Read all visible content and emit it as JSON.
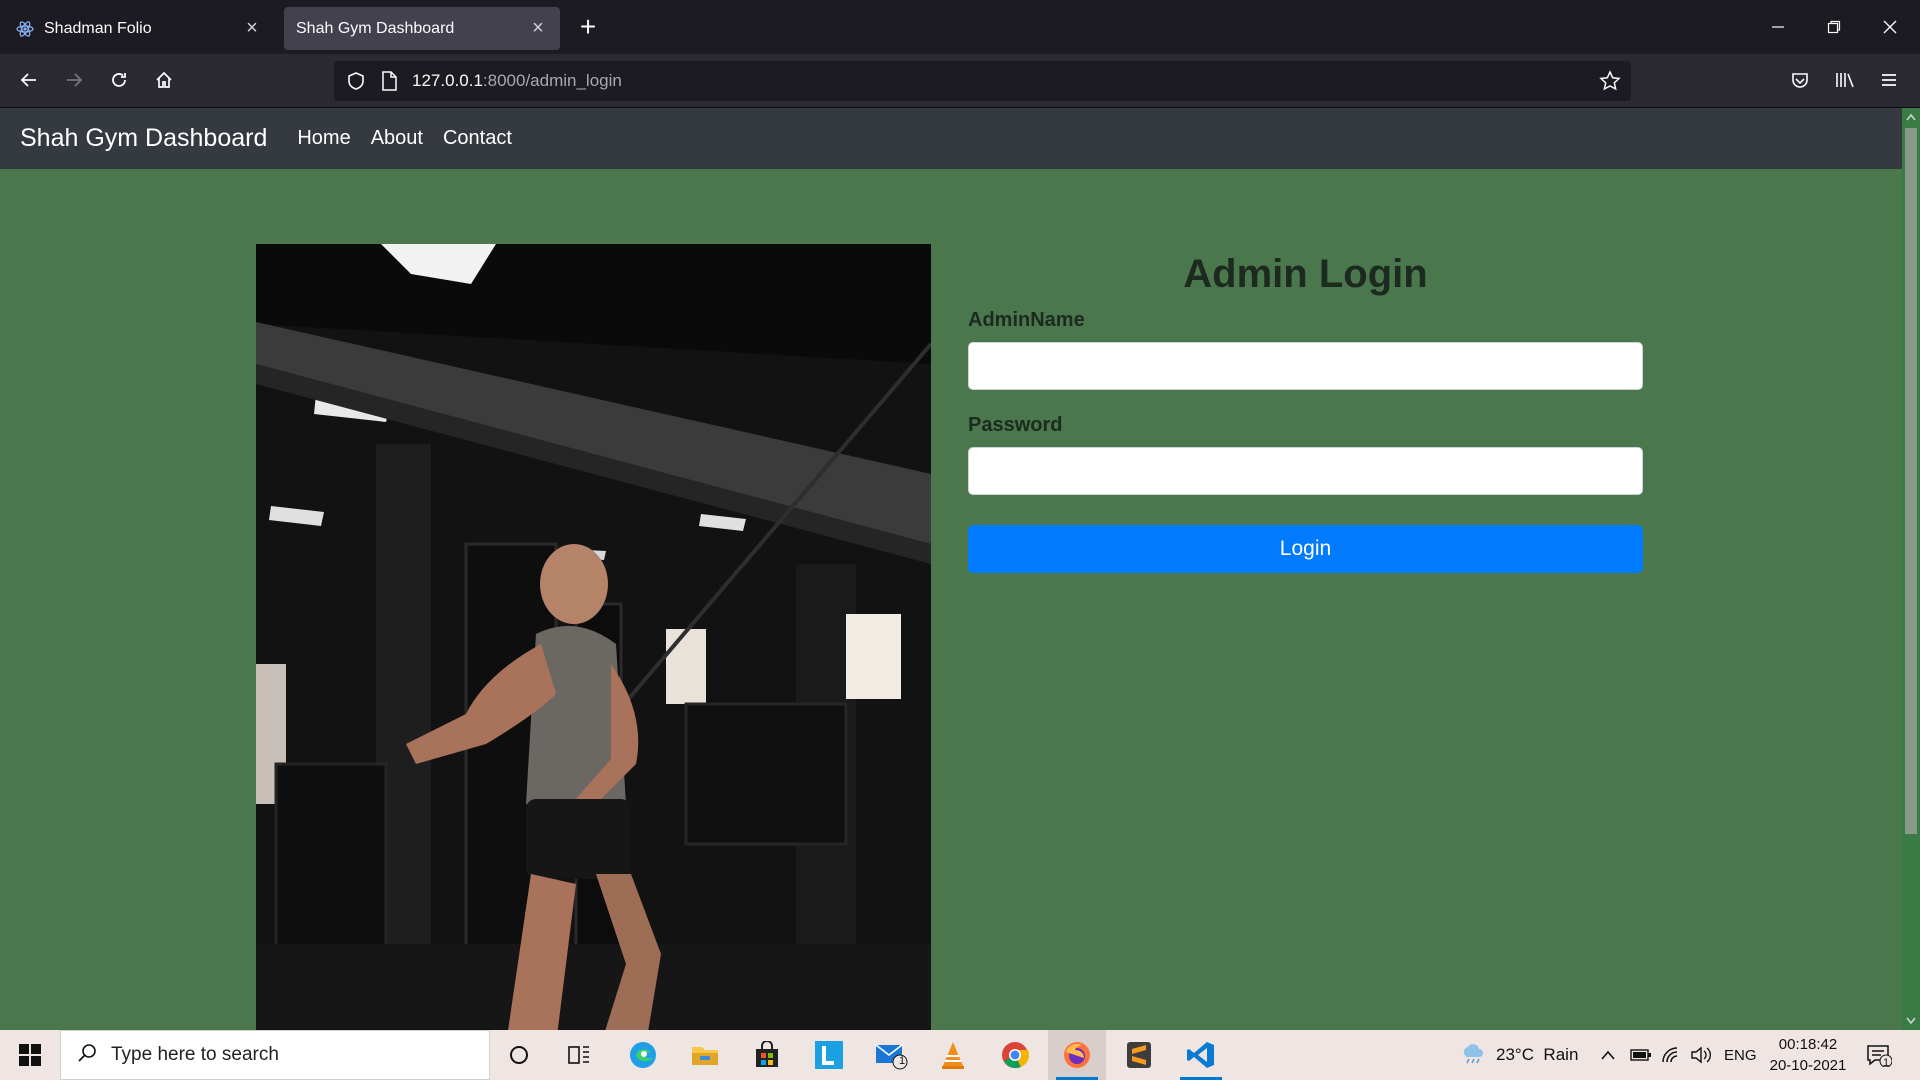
{
  "browser": {
    "tabs": [
      {
        "title": "Shadman Folio",
        "active": false
      },
      {
        "title": "Shah Gym Dashboard",
        "active": true
      }
    ],
    "url_host": "127.0.0.1",
    "url_rest": ":8000/admin_login"
  },
  "site": {
    "brand": "Shah Gym Dashboard",
    "nav": [
      "Home",
      "About",
      "Contact"
    ],
    "background": "#4a774c"
  },
  "login": {
    "heading": "Admin Login",
    "admin_label": "AdminName",
    "password_label": "Password",
    "button_label": "Login",
    "admin_value": "",
    "password_value": "",
    "button_color": "#007bff"
  },
  "taskbar": {
    "search_placeholder": "Type here to search",
    "weather": "23°C  Rain",
    "language": "ENG",
    "time": "00:18:42",
    "date": "20-10-2021",
    "mail_badge": "1",
    "notification_badge": "1"
  }
}
